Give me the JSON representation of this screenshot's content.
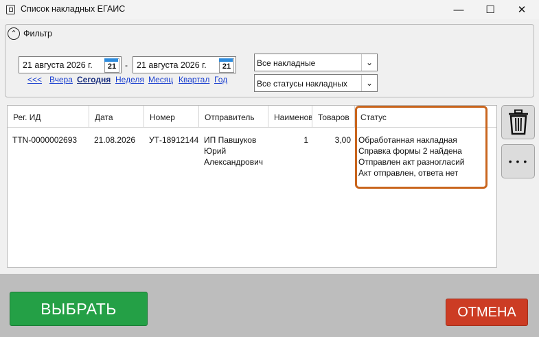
{
  "window": {
    "title": "Список накладных ЕГАИС",
    "minimize_glyph": "—",
    "maximize_glyph": "☐",
    "close_glyph": "✕"
  },
  "filter": {
    "label": "Фильтр",
    "toggle_glyph": "⌃",
    "date_from": "21 августа 2026 г.",
    "date_to": "21 августа 2026 г.",
    "calendar_day": "21",
    "date_separator": "-",
    "periods": [
      "<<<",
      "Вчера",
      "Сегодня",
      "Неделя",
      "Месяц",
      "Квартал",
      "Год"
    ],
    "active_period": "Сегодня",
    "type_select": "Все накладные",
    "status_select": "Все статусы накладных",
    "dropdown_glyph": "⌄"
  },
  "table": {
    "columns": [
      "Рег. ИД",
      "Дата",
      "Номер",
      "Отправитель",
      "Наименования",
      "Товаров",
      "Статус"
    ],
    "rows": [
      {
        "reg_id": "TTN-0000002693",
        "date": "21.08.2026",
        "number": "УТ-18912144",
        "sender": [
          "ИП Павшуков",
          "Юрий",
          "Александрович"
        ],
        "items": "1",
        "goods": "3,00",
        "status": [
          "Обработанная накладная",
          "Справка формы 2 найдена",
          "Отправлен акт разногласий",
          "Акт отправлен, ответа нет"
        ]
      }
    ],
    "highlight_color": "#c9651d"
  },
  "side_buttons": {
    "delete_icon": "trash-icon",
    "more_glyph": "• • •"
  },
  "footer": {
    "select_label": "ВЫБРАТЬ",
    "cancel_label": "ОТМЕНА",
    "select_color": "#24a046",
    "cancel_color": "#cc3c24"
  }
}
